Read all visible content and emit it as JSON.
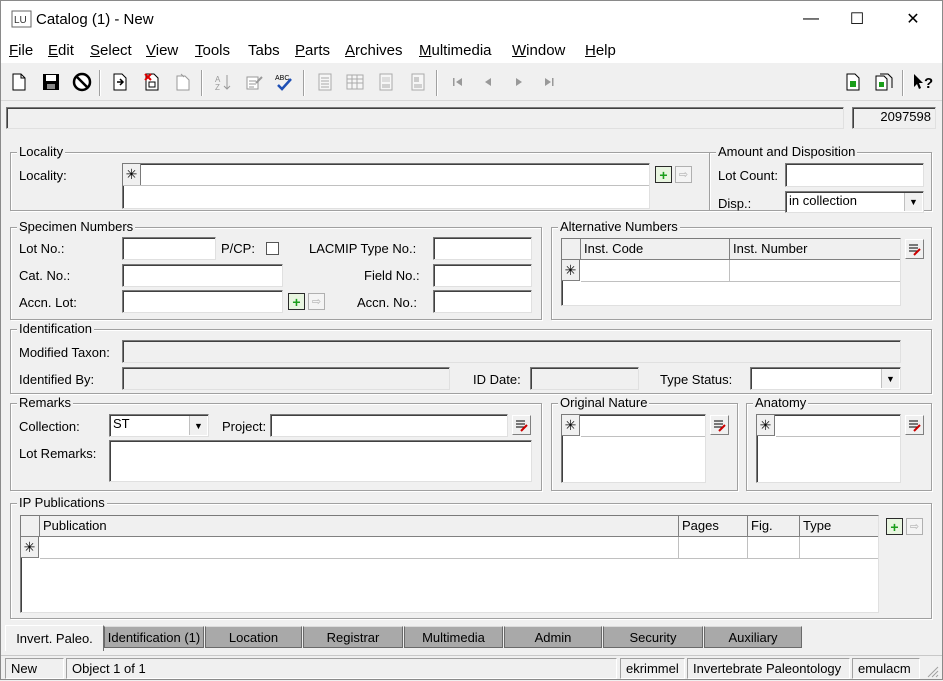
{
  "window": {
    "title": "Catalog (1) - New",
    "app_icon_text": "LU",
    "minimize": "—",
    "maximize": "☐",
    "close": "✕"
  },
  "menu": [
    {
      "label": "File",
      "key": "F",
      "rest": "ile"
    },
    {
      "label": "Edit",
      "key": "E",
      "rest": "dit"
    },
    {
      "label": "Select",
      "key": "S",
      "rest": "elect"
    },
    {
      "label": "View",
      "key": "V",
      "rest": "iew"
    },
    {
      "label": "Tools",
      "key": "T",
      "rest": "ools"
    },
    {
      "label": "Tabs",
      "key": "",
      "rest": "Tabs"
    },
    {
      "label": "Parts",
      "key": "P",
      "rest": "arts"
    },
    {
      "label": "Archives",
      "key": "A",
      "rest": "rchives"
    },
    {
      "label": "Multimedia",
      "key": "M",
      "rest": "ultimedia"
    },
    {
      "label": "Window",
      "key": "W",
      "rest": "indow"
    },
    {
      "label": "Help",
      "key": "H",
      "rest": "elp"
    }
  ],
  "record_bar": {
    "status": "",
    "record_id": "2097598"
  },
  "locality": {
    "group_title": "Locality",
    "label": "Locality:",
    "star": "✳",
    "value": ""
  },
  "amount": {
    "group_title": "Amount and Disposition",
    "lot_count_label": "Lot Count:",
    "lot_count": "",
    "disp_label": "Disp.:",
    "disp_value": "in collection"
  },
  "specimen": {
    "group_title": "Specimen Numbers",
    "lot_no_label": "Lot No.:",
    "pcp_label": "P/CP:",
    "lacmip_label": "LACMIP Type No.:",
    "cat_no_label": "Cat. No.:",
    "field_no_label": "Field No.:",
    "accn_lot_label": "Accn. Lot:",
    "accn_no_label": "Accn. No.:"
  },
  "alt_numbers": {
    "group_title": "Alternative Numbers",
    "columns": [
      "Inst. Code",
      "Inst. Number"
    ],
    "star": "✳"
  },
  "identification": {
    "group_title": "Identification",
    "modified_taxon_label": "Modified Taxon:",
    "identified_by_label": "Identified By:",
    "id_date_label": "ID Date:",
    "type_status_label": "Type Status:"
  },
  "remarks": {
    "group_title": "Remarks",
    "collection_label": "Collection:",
    "collection_value": "ST",
    "project_label": "Project:",
    "lot_remarks_label": "Lot Remarks:"
  },
  "original_nature": {
    "group_title": "Original Nature",
    "star": "✳"
  },
  "anatomy": {
    "group_title": "Anatomy",
    "star": "✳"
  },
  "publications": {
    "group_title": "IP Publications",
    "columns": [
      "Publication",
      "Pages",
      "Fig.",
      "Type"
    ],
    "star": "✳"
  },
  "tabs": [
    "Invert. Paleo.",
    "Identification (1)",
    "Location",
    "Registrar",
    "Multimedia",
    "Admin",
    "Security",
    "Auxiliary"
  ],
  "status": {
    "mode": "New",
    "object": "Object 1 of 1",
    "user": "ekrimmel",
    "department": "Invertebrate Paleontology",
    "server": "emulacm"
  },
  "icons": {
    "new": "new-document-icon",
    "save": "save-icon",
    "cancel": "cancel-icon",
    "help": "context-help-icon"
  },
  "colors": {
    "add_green": "#1a9e1a",
    "tab_inactive": "#a9a9a9",
    "window_bg": "#f0f0f0"
  }
}
